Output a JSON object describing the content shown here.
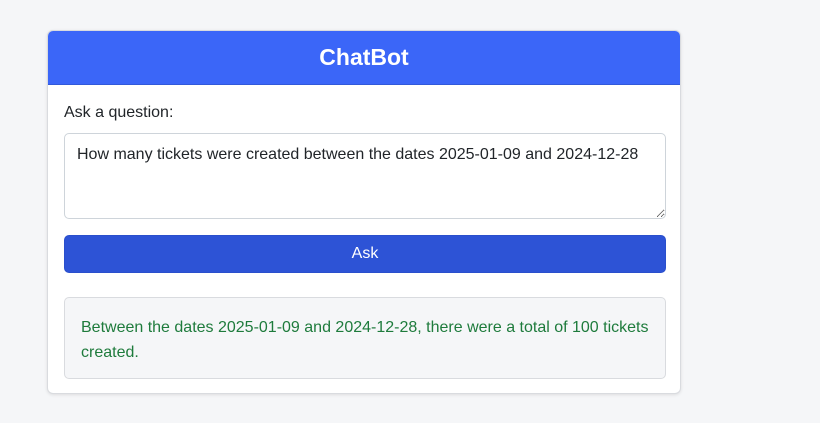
{
  "header": {
    "title": "ChatBot"
  },
  "form": {
    "label": "Ask a question:",
    "question_value": "How many tickets were created between the dates 2025-01-09 and 2024-12-28",
    "ask_label": "Ask"
  },
  "answer": {
    "text": "Between the dates 2025-01-09 and 2024-12-28, there were a total of 100 tickets created."
  },
  "colors": {
    "header_bg": "#3b66f8",
    "button_bg": "#2d53d6",
    "answer_text": "#1e7b3c",
    "page_bg": "#f5f6f8"
  }
}
